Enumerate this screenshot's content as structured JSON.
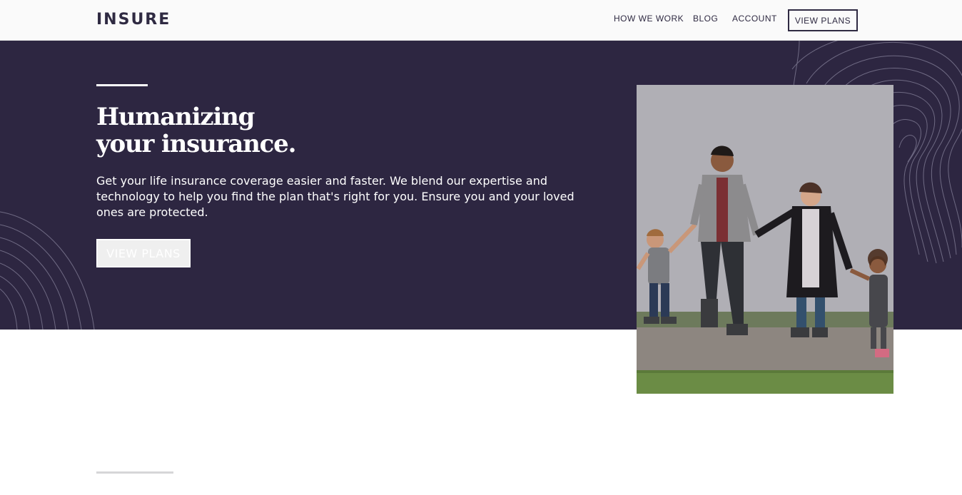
{
  "header": {
    "logo": "INSURE",
    "nav": {
      "how_we_work": "HOW WE WORK",
      "blog": "BLOG",
      "account": "ACCOUNT",
      "cta": "VIEW PLANS"
    }
  },
  "hero": {
    "title_line1": "Humanizing",
    "title_line2": "your insurance.",
    "text": "Get your life insurance coverage easier and faster. We blend our expertise and technology to help you find the plan that's right for you. Ensure you and your loved ones are protected.",
    "cta": "VIEW PLANS"
  },
  "colors": {
    "hero_bg": "#2d2641",
    "text_dark": "#2f2a42",
    "header_bg": "#fafafa"
  }
}
